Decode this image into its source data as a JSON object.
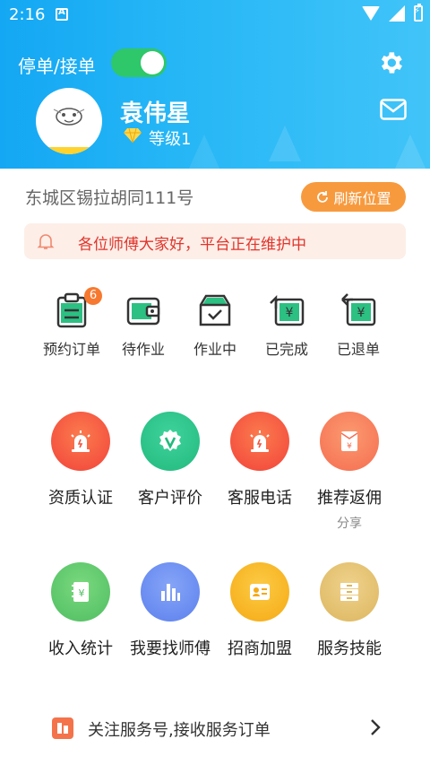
{
  "status_bar": {
    "time": "2:16"
  },
  "header": {
    "toggle_label": "停单/接单",
    "toggle_on": true,
    "username": "袁伟星",
    "level": "等级1",
    "colors": {
      "gradient_start": "#14a7f3",
      "gradient_end": "#41c4f8",
      "toggle": "#2ec76a"
    }
  },
  "location": {
    "address": "东城区锡拉胡同111号",
    "refresh_label": "刷新位置"
  },
  "notice": {
    "text": "各位师傅大家好，平台正在维护中"
  },
  "orders": [
    {
      "label": "预约订单",
      "icon": "clipboard-icon",
      "badge": "6"
    },
    {
      "label": "待作业",
      "icon": "wallet-icon"
    },
    {
      "label": "作业中",
      "icon": "inbox-check-icon"
    },
    {
      "label": "已完成",
      "icon": "yuan-refresh-icon"
    },
    {
      "label": "已退单",
      "icon": "yuan-return-icon"
    }
  ],
  "services": [
    {
      "label": "资质认证",
      "icon": "alarm-light-icon",
      "color": "#f2523a"
    },
    {
      "label": "客户评价",
      "icon": "v-badge-icon",
      "color": "#2bc48a"
    },
    {
      "label": "客服电话",
      "icon": "alarm-light-icon",
      "color": "#f2523a"
    },
    {
      "label": "推荐返佣",
      "sub": "分享",
      "icon": "red-envelope-icon",
      "color": "#f8785a"
    },
    {
      "label": "收入统计",
      "icon": "ledger-icon",
      "color": "#5cc76d"
    },
    {
      "label": "我要找师傅",
      "icon": "bar-chart-icon",
      "color": "#6c8ff3"
    },
    {
      "label": "招商加盟",
      "icon": "id-card-icon",
      "color": "#f7b21f"
    },
    {
      "label": "服务技能",
      "icon": "archive-icon",
      "color": "#e3c06f"
    }
  ],
  "follow": {
    "text": "关注服务号,接收服务订单"
  }
}
